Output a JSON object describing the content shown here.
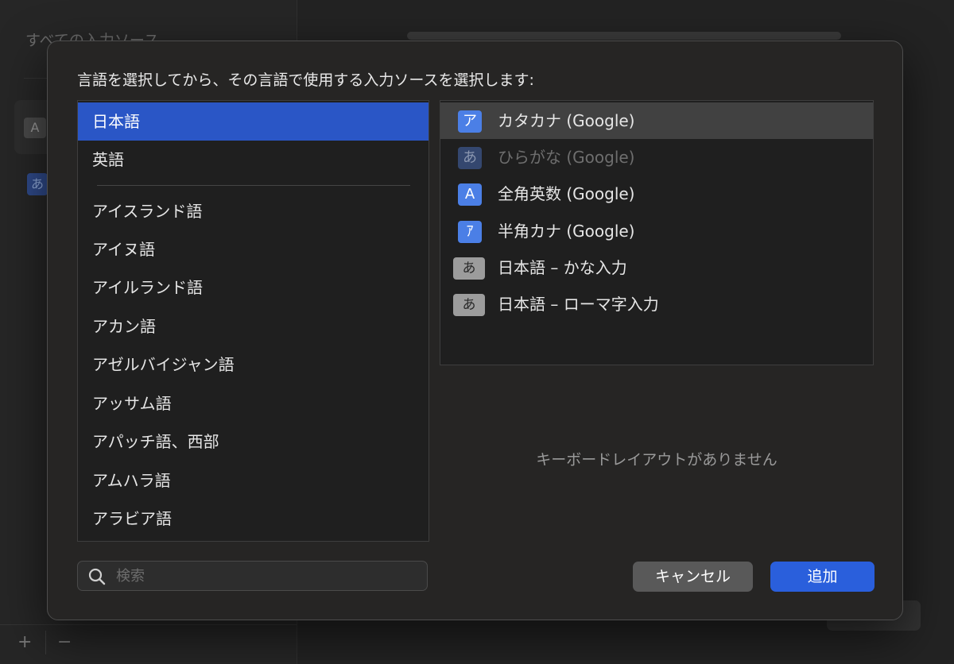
{
  "background": {
    "sidebar_title": "すべての入力ソース",
    "card_badge": "A",
    "blue_badge": "あ",
    "plus": "+",
    "minus": "−"
  },
  "dialog": {
    "instruction": "言語を選択してから、その言語で使用する入力ソースを選択します:",
    "languages_top": [
      "日本語",
      "英語"
    ],
    "languages": [
      "アイスランド語",
      "アイヌ語",
      "アイルランド語",
      "アカン語",
      "アゼルバイジャン語",
      "アッサム語",
      "アパッチ語、西部",
      "アムハラ語",
      "アラビア語"
    ],
    "selected_language": "日本語",
    "input_sources": [
      {
        "icon": "ア",
        "label": "カタカナ (Google)",
        "icon_style": "blue",
        "state": "highlighted"
      },
      {
        "icon": "あ",
        "label": "ひらがな (Google)",
        "icon_style": "blue-dim",
        "state": "disabled"
      },
      {
        "icon": "A",
        "label": "全角英数 (Google)",
        "icon_style": "blue",
        "state": "normal"
      },
      {
        "icon": "ｱ",
        "label": "半角カナ (Google)",
        "icon_style": "blue",
        "state": "normal"
      },
      {
        "icon": "あ",
        "label": "日本語 – かな入力",
        "icon_style": "gray",
        "state": "normal"
      },
      {
        "icon": "あ",
        "label": "日本語 – ローマ字入力",
        "icon_style": "gray",
        "state": "normal"
      }
    ],
    "no_layout_text": "キーボードレイアウトがありません",
    "search_placeholder": "検索",
    "cancel_label": "キャンセル",
    "add_label": "追加"
  },
  "colors": {
    "selection_blue": "#2a56c6",
    "add_button": "#2a5fdc",
    "icon_blue": "#4b7fe6"
  }
}
